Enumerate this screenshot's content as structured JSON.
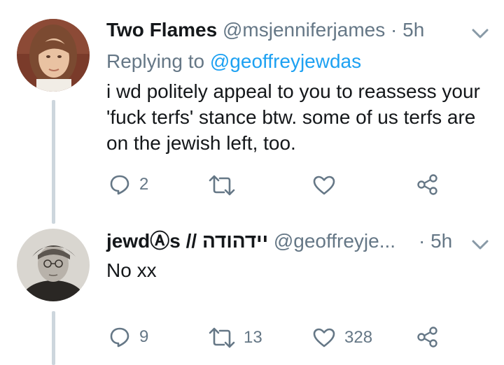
{
  "tweets": [
    {
      "name": "Two Flames",
      "handle": "@msjenniferjames",
      "separator": "·",
      "time": "5h",
      "reply_prefix": "Replying to",
      "reply_to": "@geoffreyjewdas",
      "text": "i wd politely appeal to you to reassess your 'fuck terfs' stance btw. some of us terfs are on the jewish left, too.",
      "reply_count": "2",
      "retweet_count": "",
      "like_count": ""
    },
    {
      "name": "jewdⒶs // יידהודה",
      "handle": "@geoffreyje...",
      "separator": "·",
      "time": "5h",
      "text": "No xx",
      "reply_count": "9",
      "retweet_count": "13",
      "like_count": "328"
    }
  ],
  "icons": {
    "reply": "reply-icon",
    "retweet": "retweet-icon",
    "like": "heart-icon",
    "share": "share-icon",
    "caret": "chevron-down-icon"
  },
  "colors": {
    "text": "#14171a",
    "secondary": "#657786",
    "link": "#1da1f2",
    "thread_line": "#cdd6dd"
  }
}
